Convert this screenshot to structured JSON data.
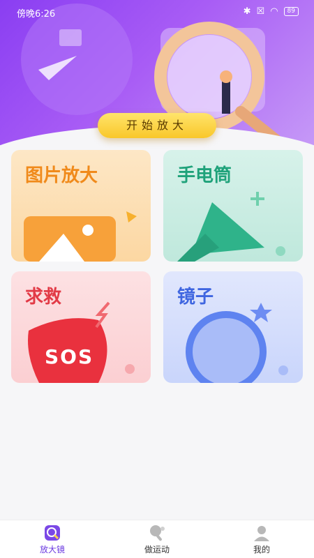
{
  "status_bar": {
    "time": "傍晚6:26",
    "battery": "89"
  },
  "hero": {
    "start_button": "开始放大"
  },
  "cards": {
    "image_zoom": "图片放大",
    "flashlight": "手电筒",
    "sos_title": "求救",
    "sos_badge": "SOS",
    "mirror": "镜子"
  },
  "bottom_nav": {
    "items": [
      {
        "label": "放大镜",
        "active": true
      },
      {
        "label": "做运动",
        "active": false
      },
      {
        "label": "我的",
        "active": false
      }
    ]
  },
  "colors": {
    "accent": "#8a3ef2",
    "button": "#f9c72a"
  }
}
